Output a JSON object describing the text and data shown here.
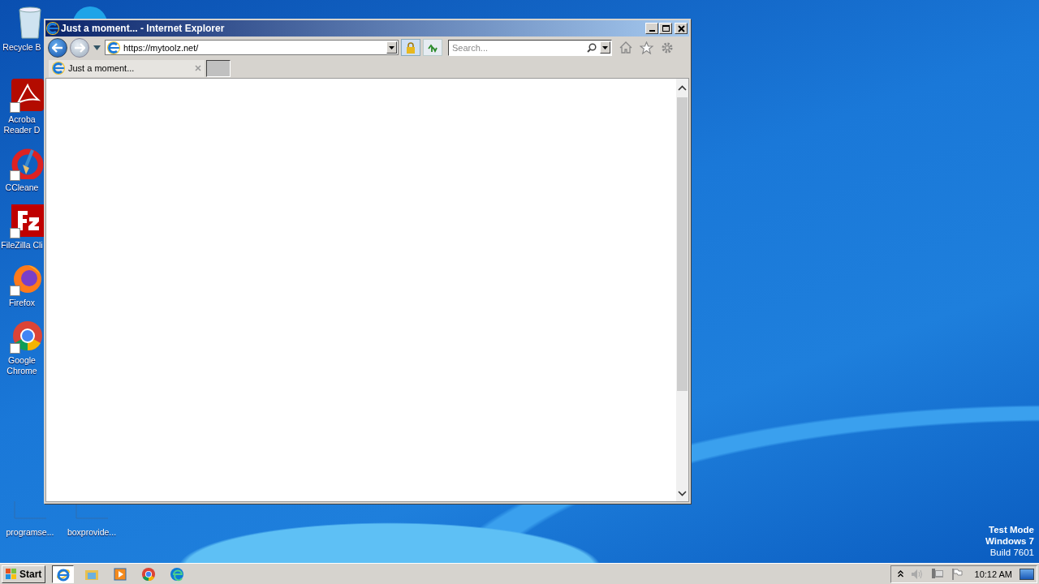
{
  "desktop_icons": [
    {
      "kind": "recycle",
      "lines": [
        "Recycle B"
      ]
    },
    {
      "kind": "acrobat",
      "lines": [
        "Acroba",
        "Reader D"
      ]
    },
    {
      "kind": "ccleaner",
      "lines": [
        "CCleane"
      ]
    },
    {
      "kind": "filezilla",
      "lines": [
        "FileZilla Cli"
      ]
    },
    {
      "kind": "firefox",
      "lines": [
        "Firefox"
      ]
    },
    {
      "kind": "chrome",
      "lines": [
        "Google",
        "Chrome"
      ]
    },
    {
      "kind": "file",
      "lines": [
        "programse..."
      ]
    },
    {
      "kind": "file",
      "lines": [
        "boxprovide..."
      ]
    }
  ],
  "window": {
    "title": "Just a moment... - Internet Explorer",
    "address": "https://mytoolz.net/",
    "search": {
      "placeholder": "Search..."
    },
    "tabs": [
      {
        "label": "Just a moment...",
        "selected": true
      }
    ]
  },
  "os_watermark": [
    "Test Mode",
    "Windows 7",
    "Build 7601"
  ],
  "taskbar": {
    "start": "Start",
    "apps": [
      {
        "kind": "ie",
        "selected": true
      },
      {
        "kind": "explorer",
        "selected": false
      },
      {
        "kind": "media",
        "selected": false
      },
      {
        "kind": "chrome",
        "selected": false
      },
      {
        "kind": "edge",
        "selected": false
      }
    ],
    "clock": "10:12 AM"
  }
}
